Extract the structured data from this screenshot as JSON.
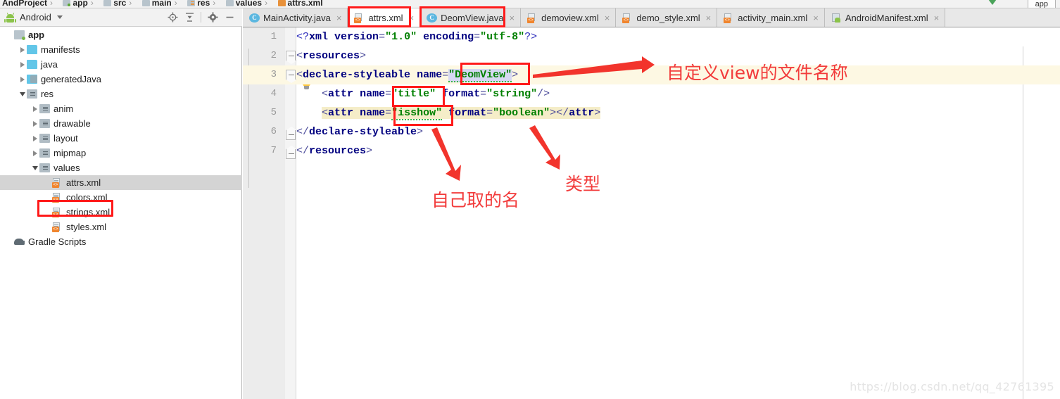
{
  "breadcrumb": {
    "items": [
      "AndProject",
      "app",
      "src",
      "main",
      "res",
      "values",
      "attrs.xml"
    ],
    "button_label": "app"
  },
  "project_panel": {
    "title": "Android",
    "toolbar_icons": [
      "locate-target-icon",
      "collapse-all-icon",
      "settings-gear-icon",
      "minimize-icon"
    ],
    "tree": [
      {
        "label": "app",
        "depth": 0,
        "arrow": "none",
        "icon": "module",
        "bold": true,
        "selected": false
      },
      {
        "label": "manifests",
        "depth": 1,
        "arrow": "right",
        "icon": "folder",
        "bold": false,
        "selected": false
      },
      {
        "label": "java",
        "depth": 1,
        "arrow": "right",
        "icon": "folder",
        "bold": false,
        "selected": false
      },
      {
        "label": "generatedJava",
        "depth": 1,
        "arrow": "right",
        "icon": "folder-gen",
        "bold": false,
        "selected": false
      },
      {
        "label": "res",
        "depth": 1,
        "arrow": "down",
        "icon": "folder-res",
        "bold": false,
        "selected": false
      },
      {
        "label": "anim",
        "depth": 2,
        "arrow": "right",
        "icon": "folder-res2",
        "bold": false,
        "selected": false
      },
      {
        "label": "drawable",
        "depth": 2,
        "arrow": "right",
        "icon": "folder-res2",
        "bold": false,
        "selected": false
      },
      {
        "label": "layout",
        "depth": 2,
        "arrow": "right",
        "icon": "folder-res2",
        "bold": false,
        "selected": false
      },
      {
        "label": "mipmap",
        "depth": 2,
        "arrow": "right",
        "icon": "folder-res2",
        "bold": false,
        "selected": false
      },
      {
        "label": "values",
        "depth": 2,
        "arrow": "down",
        "icon": "folder-res2",
        "bold": false,
        "selected": false
      },
      {
        "label": "attrs.xml",
        "depth": 3,
        "arrow": "none",
        "icon": "xml",
        "bold": false,
        "selected": true
      },
      {
        "label": "colors.xml",
        "depth": 3,
        "arrow": "none",
        "icon": "xml",
        "bold": false,
        "selected": false
      },
      {
        "label": "strings.xml",
        "depth": 3,
        "arrow": "none",
        "icon": "xml",
        "bold": false,
        "selected": false
      },
      {
        "label": "styles.xml",
        "depth": 3,
        "arrow": "none",
        "icon": "xml",
        "bold": false,
        "selected": false
      },
      {
        "label": "Gradle Scripts",
        "depth": 0,
        "arrow": "none",
        "icon": "elephant",
        "bold": false,
        "selected": false
      }
    ]
  },
  "editor": {
    "tabs": [
      {
        "label": "MainActivity.java",
        "icon": "java-class-icon",
        "active": false,
        "highlighted": false
      },
      {
        "label": "attrs.xml",
        "icon": "xml-file-icon",
        "active": true,
        "highlighted": true
      },
      {
        "label": "DeomView.java",
        "icon": "java-class-icon",
        "active": false,
        "highlighted": true
      },
      {
        "label": "demoview.xml",
        "icon": "xml-file-icon",
        "active": false,
        "highlighted": false
      },
      {
        "label": "demo_style.xml",
        "icon": "xml-file-icon",
        "active": false,
        "highlighted": false
      },
      {
        "label": "activity_main.xml",
        "icon": "xml-file-icon",
        "active": false,
        "highlighted": false
      },
      {
        "label": "AndroidManifest.xml",
        "icon": "android-manifest-icon",
        "active": false,
        "highlighted": false
      }
    ],
    "close_glyph": "×",
    "line_numbers": [
      "1",
      "2",
      "3",
      "4",
      "5",
      "6",
      "7"
    ],
    "lines": [
      {
        "n": "1",
        "text": "<?xml version=\"1.0\" encoding=\"utf-8\"?>"
      },
      {
        "n": "2",
        "text": "<resources>"
      },
      {
        "n": "3",
        "text": "<declare-styleable name=\"DeomView\">"
      },
      {
        "n": "4",
        "text": "    <attr name=\"title\" format=\"string\"/>"
      },
      {
        "n": "5",
        "text": "    <attr name=\"isshow\" format=\"boolean\"></attr>"
      },
      {
        "n": "6",
        "text": "</declare-styleable>"
      },
      {
        "n": "7",
        "text": "</resources>"
      }
    ]
  },
  "annotations": {
    "filename_label": "自定义view的文件名称",
    "name_label": "自己取的名",
    "type_label": "类型"
  },
  "watermark": "https://blog.csdn.net/qq_42761395",
  "colors": {
    "annotation_red": "#f23b3b",
    "highlight_box": "#ff1a1a",
    "current_line": "#fdf8e3",
    "selection": "#d6d8f2"
  }
}
